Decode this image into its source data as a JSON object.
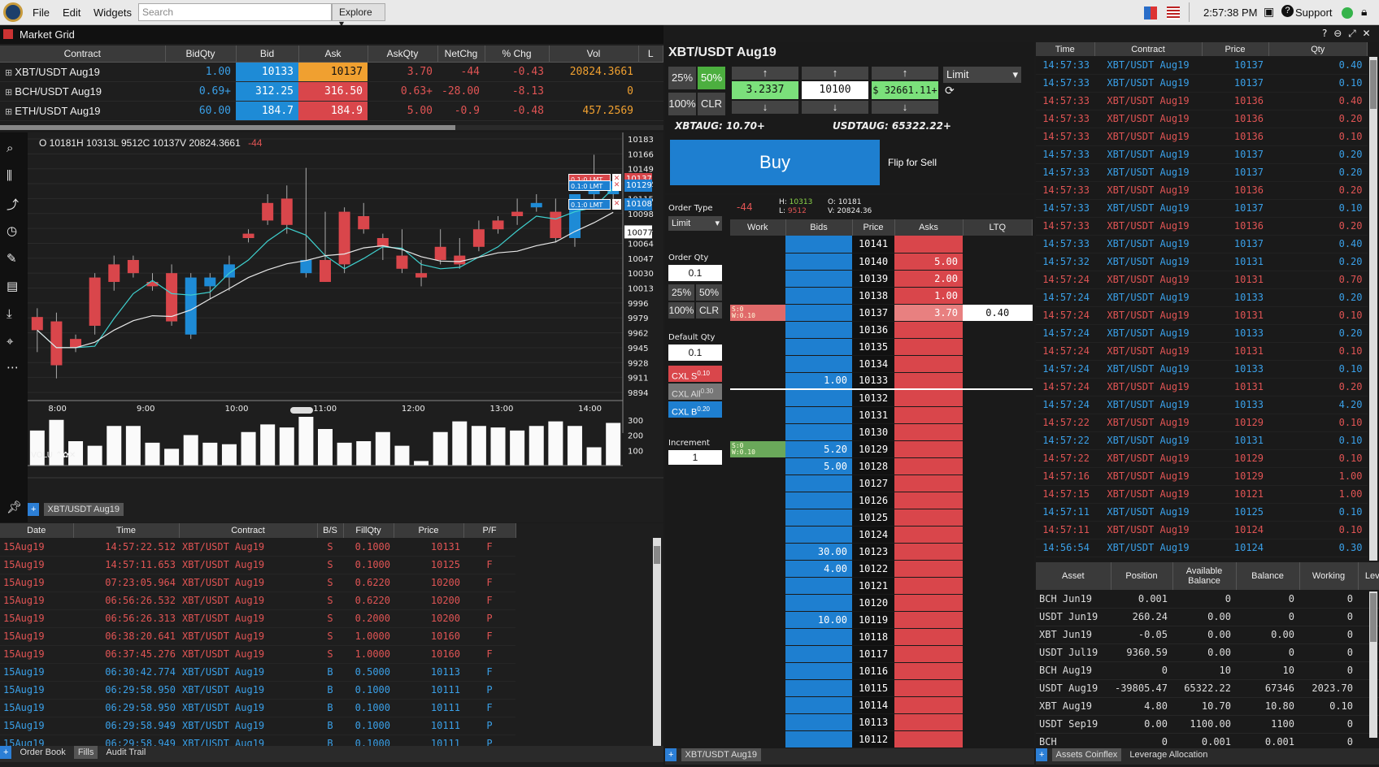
{
  "topbar": {
    "menu": [
      "File",
      "Edit",
      "Widgets"
    ],
    "search_placeholder": "Search",
    "explore": "Explore ▾",
    "clock": "2:57:38 PM",
    "support": "Support"
  },
  "market_grid": {
    "title": "Market Grid",
    "headers": [
      "Contract",
      "BidQty",
      "Bid",
      "Ask",
      "AskQty",
      "NetChg",
      "% Chg",
      "Vol",
      "L"
    ],
    "rows": [
      {
        "contract": "XBT/USDT  Aug19",
        "bidqty": "1.00",
        "bid": "10133",
        "ask": "10137",
        "askqty": "3.70",
        "netchg": "-44",
        "pchg": "-0.43",
        "vol": "20824.3661"
      },
      {
        "contract": "BCH/USDT  Aug19",
        "bidqty": "0.69+",
        "bid": "312.25",
        "ask": "316.50",
        "askqty": "0.63+",
        "netchg": "-28.00",
        "pchg": "-8.13",
        "vol": "0"
      },
      {
        "contract": "ETH/USDT  Aug19",
        "bidqty": "60.00",
        "bid": "184.7",
        "ask": "184.9",
        "askqty": "5.00",
        "netchg": "-0.9",
        "pchg": "-0.48",
        "vol": "457.2569"
      }
    ]
  },
  "chart": {
    "ohlc_label": "O  10181H  10313L  9512C  10137V  20824.3661",
    "chg": "-44",
    "volume_label": "VOLU",
    "symbol_tab": "XBT/USDT Aug19",
    "price_ticks": [
      "10183",
      "10166",
      "10149",
      "10132",
      "10115",
      "10098",
      "10081",
      "10064",
      "10047",
      "10030",
      "10013",
      "9996",
      "9979",
      "9962",
      "9945",
      "9928",
      "9911",
      "9894"
    ],
    "current_price": "10077",
    "vol_ticks": [
      "300",
      "200",
      "100"
    ],
    "order_tags": [
      {
        "text": "0.1:0  LMT",
        "price": "10137"
      },
      {
        "text": "0.1:0  LMT",
        "price": "10129"
      },
      {
        "text": "0.1:0  LMT",
        "price": "10108"
      }
    ]
  },
  "chart_data": {
    "type": "candlestick",
    "x": [
      "8:00",
      "9:00",
      "10:00",
      "11:00",
      "12:00",
      "13:00",
      "14:00"
    ],
    "candles": [
      [
        9980,
        9990,
        9940,
        9965
      ],
      [
        9975,
        9985,
        9910,
        9925
      ],
      [
        9955,
        9960,
        9940,
        9945
      ],
      [
        10025,
        10030,
        9960,
        9970
      ],
      [
        10040,
        10050,
        10010,
        10020
      ],
      [
        10045,
        10050,
        10025,
        10030
      ],
      [
        10020,
        10030,
        10010,
        10015
      ],
      [
        10030,
        10040,
        9970,
        9975
      ],
      [
        9960,
        10030,
        9955,
        10025
      ],
      [
        10015,
        10030,
        10000,
        10025
      ],
      [
        10025,
        10050,
        10010,
        10040
      ],
      [
        10075,
        10080,
        10065,
        10070
      ],
      [
        10110,
        10120,
        10085,
        10090
      ],
      [
        10115,
        10130,
        10075,
        10085
      ],
      [
        10030,
        10150,
        10025,
        10045
      ],
      [
        10045,
        10100,
        10020,
        10020
      ],
      [
        10100,
        10105,
        10030,
        10040
      ],
      [
        10095,
        10110,
        10075,
        10080
      ],
      [
        10070,
        10075,
        10045,
        10060
      ],
      [
        10050,
        10080,
        10030,
        10035
      ],
      [
        10030,
        10045,
        10015,
        10025
      ],
      [
        10060,
        10080,
        10040,
        10045
      ],
      [
        10050,
        10070,
        10035,
        10040
      ],
      [
        10080,
        10090,
        10055,
        10060
      ],
      [
        10090,
        10095,
        10075,
        10080
      ],
      [
        10100,
        10115,
        10085,
        10095
      ],
      [
        10105,
        10120,
        10100,
        10110
      ],
      [
        10100,
        10115,
        10065,
        10070
      ],
      [
        10070,
        10120,
        10060,
        10120
      ],
      [
        10120,
        10165,
        10110,
        10125
      ],
      [
        10120,
        10140,
        10110,
        10135
      ]
    ],
    "volume": [
      230,
      300,
      160,
      130,
      260,
      260,
      150,
      110,
      200,
      150,
      140,
      220,
      270,
      250,
      320,
      240,
      150,
      160,
      220,
      130,
      30,
      220,
      290,
      260,
      250,
      230,
      260,
      290,
      260,
      120,
      280
    ],
    "ylim": [
      9894,
      10183
    ],
    "vol_ylim": [
      0,
      320
    ]
  },
  "order_ticket": {
    "title": "XBT/USDT Aug19",
    "pct": [
      "25%",
      "50%",
      "100%",
      "CLR"
    ],
    "qty": "3.2337",
    "price": "10100",
    "total": "$ 32661.11+",
    "order_type": "Limit",
    "xbt_avail": "XBTAUG: 10.70+",
    "usdt_avail": "USDTAUG: 65322.22+",
    "buy": "Buy",
    "flip": "Flip for Sell"
  },
  "ladder": {
    "chg": "-44",
    "high": "10313",
    "low": "9512",
    "open": "10181",
    "volume": "20824.36",
    "order_type_label": "Order Type",
    "order_type": "Limit",
    "order_qty_label": "Order Qty",
    "order_qty": "0.1",
    "pct": [
      "25%",
      "50%",
      "100%",
      "CLR"
    ],
    "default_qty_label": "Default Qty",
    "default_qty": "0.1",
    "cxl_s": "CXL  S",
    "cxl_s_q": "0.10",
    "cxl_all": "CXL All",
    "cxl_all_q": "0.30",
    "cxl_b": "CXL  B",
    "cxl_b_q": "0.20",
    "increment_label": "Increment",
    "increment": "1",
    "headers": [
      "Work",
      "Bids",
      "Price",
      "Asks",
      "LTQ"
    ],
    "work_sell": {
      "s": "S:0",
      "w": "W:0.10"
    },
    "work_buy": {
      "s": "S:0",
      "w": "W:0.10"
    },
    "rows": [
      [
        "",
        "",
        "10141",
        "",
        ""
      ],
      [
        "",
        "",
        "10140",
        "5.00",
        ""
      ],
      [
        "",
        "",
        "10139",
        "2.00",
        ""
      ],
      [
        "",
        "",
        "10138",
        "1.00",
        ""
      ],
      [
        "ws",
        "",
        "10137",
        "3.70",
        "0.40"
      ],
      [
        "",
        "",
        "10136",
        "",
        ""
      ],
      [
        "",
        "",
        "10135",
        "",
        ""
      ],
      [
        "",
        "",
        "10134",
        "",
        ""
      ],
      [
        "",
        "1.00",
        "10133",
        "",
        ""
      ],
      [
        "",
        "",
        "10132",
        "",
        ""
      ],
      [
        "",
        "",
        "10131",
        "",
        ""
      ],
      [
        "",
        "",
        "10130",
        "",
        ""
      ],
      [
        "wb",
        "5.20",
        "10129",
        "",
        ""
      ],
      [
        "",
        "5.00",
        "10128",
        "",
        ""
      ],
      [
        "",
        "",
        "10127",
        "",
        ""
      ],
      [
        "",
        "",
        "10126",
        "",
        ""
      ],
      [
        "",
        "",
        "10125",
        "",
        ""
      ],
      [
        "",
        "",
        "10124",
        "",
        ""
      ],
      [
        "",
        "30.00",
        "10123",
        "",
        ""
      ],
      [
        "",
        "4.00",
        "10122",
        "",
        ""
      ],
      [
        "",
        "",
        "10121",
        "",
        ""
      ],
      [
        "",
        "",
        "10120",
        "",
        ""
      ],
      [
        "",
        "10.00",
        "10119",
        "",
        ""
      ],
      [
        "",
        "",
        "10118",
        "",
        ""
      ],
      [
        "",
        "",
        "10117",
        "",
        ""
      ],
      [
        "",
        "",
        "10116",
        "",
        ""
      ],
      [
        "",
        "",
        "10115",
        "",
        ""
      ],
      [
        "",
        "",
        "10114",
        "",
        ""
      ],
      [
        "",
        "",
        "10113",
        "",
        ""
      ],
      [
        "",
        "",
        "10112",
        "",
        ""
      ]
    ],
    "tab": "XBT/USDT Aug19"
  },
  "time_sales": {
    "headers": [
      "Time",
      "Contract",
      "Price",
      "Qty"
    ],
    "rows": [
      [
        "14:57:33",
        "XBT/USDT  Aug19",
        "10137",
        "0.40",
        "b"
      ],
      [
        "14:57:33",
        "XBT/USDT  Aug19",
        "10137",
        "0.10",
        "b"
      ],
      [
        "14:57:33",
        "XBT/USDT  Aug19",
        "10136",
        "0.40",
        "s"
      ],
      [
        "14:57:33",
        "XBT/USDT  Aug19",
        "10136",
        "0.20",
        "s"
      ],
      [
        "14:57:33",
        "XBT/USDT  Aug19",
        "10136",
        "0.10",
        "s"
      ],
      [
        "14:57:33",
        "XBT/USDT  Aug19",
        "10137",
        "0.20",
        "b"
      ],
      [
        "14:57:33",
        "XBT/USDT  Aug19",
        "10137",
        "0.20",
        "b"
      ],
      [
        "14:57:33",
        "XBT/USDT  Aug19",
        "10136",
        "0.20",
        "s"
      ],
      [
        "14:57:33",
        "XBT/USDT  Aug19",
        "10137",
        "0.10",
        "b"
      ],
      [
        "14:57:33",
        "XBT/USDT  Aug19",
        "10136",
        "0.20",
        "s"
      ],
      [
        "14:57:33",
        "XBT/USDT  Aug19",
        "10137",
        "0.40",
        "b"
      ],
      [
        "14:57:32",
        "XBT/USDT  Aug19",
        "10131",
        "0.20",
        "b"
      ],
      [
        "14:57:24",
        "XBT/USDT  Aug19",
        "10131",
        "0.70",
        "s"
      ],
      [
        "14:57:24",
        "XBT/USDT  Aug19",
        "10133",
        "0.20",
        "b"
      ],
      [
        "14:57:24",
        "XBT/USDT  Aug19",
        "10131",
        "0.10",
        "s"
      ],
      [
        "14:57:24",
        "XBT/USDT  Aug19",
        "10133",
        "0.20",
        "b"
      ],
      [
        "14:57:24",
        "XBT/USDT  Aug19",
        "10131",
        "0.10",
        "s"
      ],
      [
        "14:57:24",
        "XBT/USDT  Aug19",
        "10133",
        "0.10",
        "b"
      ],
      [
        "14:57:24",
        "XBT/USDT  Aug19",
        "10131",
        "0.20",
        "s"
      ],
      [
        "14:57:24",
        "XBT/USDT  Aug19",
        "10133",
        "4.20",
        "b"
      ],
      [
        "14:57:22",
        "XBT/USDT  Aug19",
        "10129",
        "0.10",
        "s"
      ],
      [
        "14:57:22",
        "XBT/USDT  Aug19",
        "10131",
        "0.10",
        "b"
      ],
      [
        "14:57:22",
        "XBT/USDT  Aug19",
        "10129",
        "0.10",
        "s"
      ],
      [
        "14:57:16",
        "XBT/USDT  Aug19",
        "10129",
        "1.00",
        "s"
      ],
      [
        "14:57:15",
        "XBT/USDT  Aug19",
        "10121",
        "1.00",
        "s"
      ],
      [
        "14:57:11",
        "XBT/USDT  Aug19",
        "10125",
        "0.10",
        "b"
      ],
      [
        "14:57:11",
        "XBT/USDT  Aug19",
        "10124",
        "0.10",
        "s"
      ],
      [
        "14:56:54",
        "XBT/USDT  Aug19",
        "10124",
        "0.30",
        "b"
      ]
    ]
  },
  "assets": {
    "headers": [
      "Asset",
      "Position",
      "Available Balance",
      "Balance",
      "Working",
      "Lev"
    ],
    "rows": [
      [
        "BCH  Jun19",
        "0.001",
        "0",
        "0",
        "0"
      ],
      [
        "USDT  Jun19",
        "260.24",
        "0.00",
        "0",
        "0"
      ],
      [
        "XBT  Jun19",
        "-0.05",
        "0.00",
        "0.00",
        "0"
      ],
      [
        "USDT  Jul19",
        "9360.59",
        "0.00",
        "0",
        "0"
      ],
      [
        "BCH  Aug19",
        "0",
        "10",
        "10",
        "0"
      ],
      [
        "USDT  Aug19",
        "-39805.47",
        "65322.22",
        "67346",
        "2023.70"
      ],
      [
        "XBT  Aug19",
        "4.80",
        "10.70",
        "10.80",
        "0.10"
      ],
      [
        "USDT  Sep19",
        "0.00",
        "1100.00",
        "1100",
        "0"
      ],
      [
        "BCH",
        "0",
        "0.001",
        "0.001",
        "0"
      ]
    ],
    "tabs": [
      "Assets Coinflex",
      "Leverage Allocation"
    ]
  },
  "fills": {
    "headers": [
      "Date",
      "Time",
      "Contract",
      "B/S",
      "FillQty",
      "Price",
      "P/F"
    ],
    "rows": [
      [
        "15Aug19",
        "14:57:22.512",
        "XBT/USDT  Aug19",
        "S",
        "0.1000",
        "10131",
        "F"
      ],
      [
        "15Aug19",
        "14:57:11.653",
        "XBT/USDT  Aug19",
        "S",
        "0.1000",
        "10125",
        "F"
      ],
      [
        "15Aug19",
        "07:23:05.964",
        "XBT/USDT  Aug19",
        "S",
        "0.6220",
        "10200",
        "F"
      ],
      [
        "15Aug19",
        "06:56:26.532",
        "XBT/USDT  Aug19",
        "S",
        "0.6220",
        "10200",
        "F"
      ],
      [
        "15Aug19",
        "06:56:26.313",
        "XBT/USDT  Aug19",
        "S",
        "0.2000",
        "10200",
        "P"
      ],
      [
        "15Aug19",
        "06:38:20.641",
        "XBT/USDT  Aug19",
        "S",
        "1.0000",
        "10160",
        "F"
      ],
      [
        "15Aug19",
        "06:37:45.276",
        "XBT/USDT  Aug19",
        "S",
        "1.0000",
        "10160",
        "F"
      ],
      [
        "15Aug19",
        "06:30:42.774",
        "XBT/USDT  Aug19",
        "B",
        "0.5000",
        "10113",
        "F"
      ],
      [
        "15Aug19",
        "06:29:58.950",
        "XBT/USDT  Aug19",
        "B",
        "0.1000",
        "10111",
        "P"
      ],
      [
        "15Aug19",
        "06:29:58.950",
        "XBT/USDT  Aug19",
        "B",
        "0.1000",
        "10111",
        "F"
      ],
      [
        "15Aug19",
        "06:29:58.949",
        "XBT/USDT  Aug19",
        "B",
        "0.1000",
        "10111",
        "P"
      ],
      [
        "15Aug19",
        "06:29:58.949",
        "XBT/USDT  Aug19",
        "B",
        "0.1000",
        "10111",
        "P"
      ]
    ],
    "tabs": [
      "Order Book",
      "Fills",
      "Audit Trail"
    ]
  },
  "colors": {
    "buy": "#3aa0e8",
    "sell": "#e05454",
    "bid": "#1e8bd6",
    "ask": "#d9464b"
  }
}
